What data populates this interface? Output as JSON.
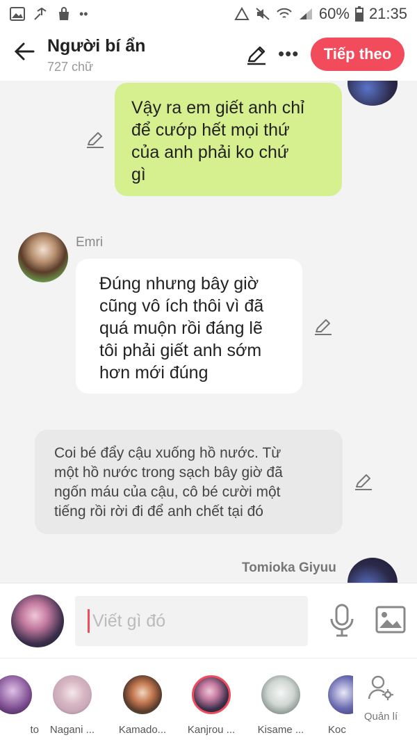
{
  "status": {
    "battery": "60%",
    "time": "21:35",
    "left_icons": [
      "image-icon",
      "share-icon",
      "bag-icon",
      "dots-icon"
    ]
  },
  "header": {
    "title": "Người bí ẩn",
    "word_count": "727 chữ",
    "next_label": "Tiếp theo"
  },
  "messages": [
    {
      "sender": "",
      "side": "right",
      "text_lines": [
        "Vậy ra em giết anh chỉ",
        "để cướp hết mọi thứ",
        "của anh phải ko chứ",
        "gì"
      ]
    },
    {
      "sender": "Emri",
      "side": "left",
      "text_lines": [
        "Đúng nhưng bây giờ",
        "cũng vô ích thôi vì đã",
        "quá muộn rồi đáng lẽ",
        "tôi phải giết anh sớm",
        "hơn mới đúng"
      ]
    },
    {
      "sender": "",
      "side": "narration",
      "text_lines": [
        "Coi bé đẩy cậu xuống hồ nước. Từ",
        "một hồ nước trong sạch bây giờ đã",
        "ngốn máu của cậu, cô bé cười một",
        "tiếng rồi rời đi để anh chết tại đó"
      ]
    },
    {
      "sender": "Tomioka Giyuu",
      "side": "right",
      "text_lines": []
    }
  ],
  "input": {
    "placeholder": "Viết gì đó"
  },
  "characters": [
    {
      "name": "to",
      "color": "#7a4a8e"
    },
    {
      "name": "Nagani ...",
      "color": "#c9a8b8"
    },
    {
      "name": "Kamado...",
      "color": "#5a3a2c"
    },
    {
      "name": "Kanjrou ...",
      "color": "#3a2e4a",
      "selected": true
    },
    {
      "name": "Kisame ...",
      "color": "#cfd6d2"
    },
    {
      "name": "Koc",
      "color": "#6a6ab0"
    }
  ],
  "manage_label": "Quản lí",
  "colors": {
    "accent": "#f24b5c",
    "my_bubble": "#d6f08f",
    "other_bubble": "#ffffff",
    "narration": "#e9e9e9"
  }
}
